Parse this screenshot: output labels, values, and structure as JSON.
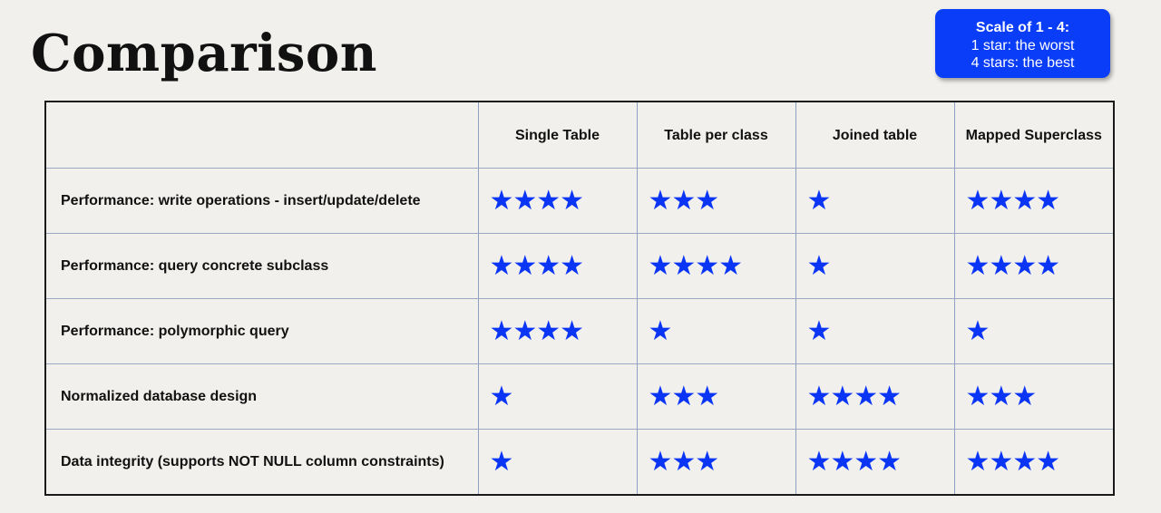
{
  "slide": {
    "title": "Comparison",
    "scale": {
      "title": "Scale of 1 - 4:",
      "line1": "1 star: the worst",
      "line2": "4 stars: the best"
    }
  },
  "colors": {
    "star": "#0b35f5",
    "scale_box": "#0a3df7",
    "background": "#f1f0ec"
  },
  "table": {
    "columns": [
      "",
      "Single Table",
      "Table per class",
      "Joined table",
      "Mapped Superclass"
    ],
    "rows": [
      {
        "label": "Performance: write operations - insert/update/delete",
        "ratings": [
          4,
          3,
          1,
          4
        ]
      },
      {
        "label": "Performance: query concrete subclass",
        "ratings": [
          4,
          4,
          1,
          4
        ]
      },
      {
        "label": "Performance: polymorphic query",
        "ratings": [
          4,
          1,
          1,
          1
        ]
      },
      {
        "label": "Normalized database design",
        "ratings": [
          1,
          3,
          4,
          3
        ]
      },
      {
        "label": "Data integrity (supports NOT NULL column constraints)",
        "ratings": [
          1,
          3,
          4,
          4
        ]
      }
    ]
  }
}
